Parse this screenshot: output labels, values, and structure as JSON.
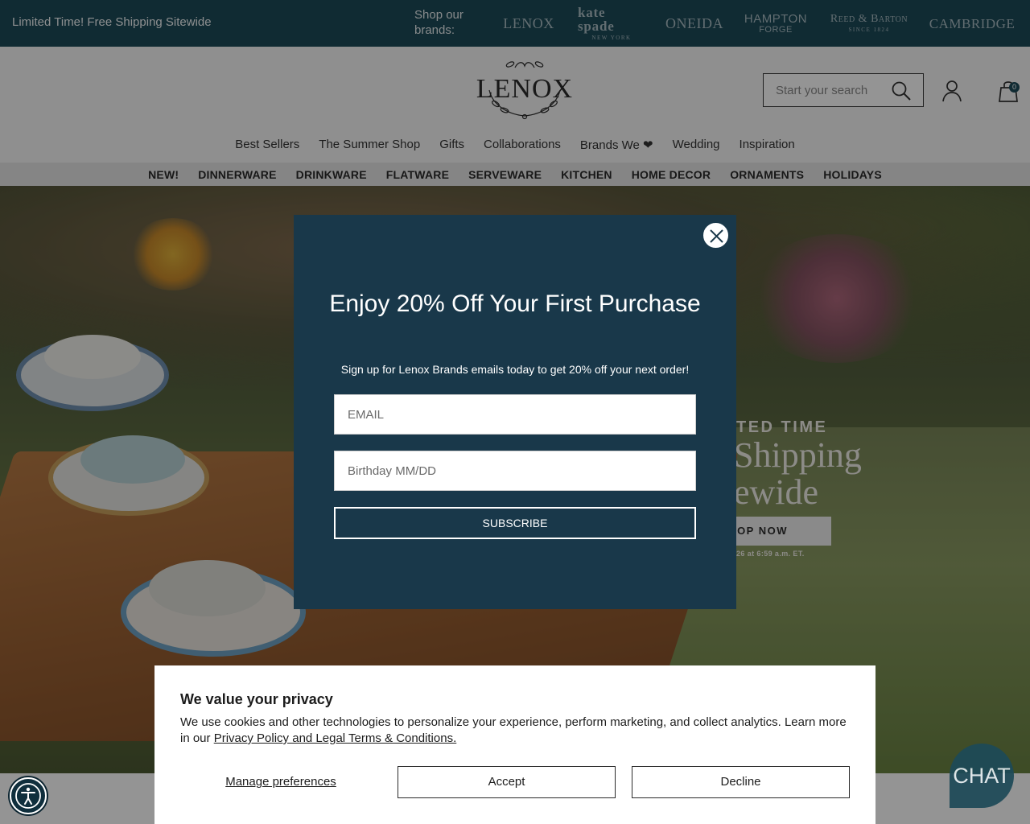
{
  "topbar": {
    "promo": "Limited Time! Free Shipping Sitewide",
    "shop_our_brands": "Shop our brands:",
    "brands": [
      {
        "name": "LENOX",
        "sub": ""
      },
      {
        "name": "kate spade",
        "sub": "NEW YORK"
      },
      {
        "name": "ONEIDA",
        "sub": ""
      },
      {
        "name": "HAMPTON",
        "sub": "FORGE"
      },
      {
        "name": "Reed & Barton",
        "sub": "SINCE 1824"
      },
      {
        "name": "CAMBRIDGE",
        "sub": ""
      }
    ]
  },
  "header": {
    "logo_text": "LENOX",
    "search_placeholder": "Start your search",
    "cart_count": "0",
    "primary_nav": [
      "Best Sellers",
      "The Summer Shop",
      "Gifts",
      "Collaborations",
      "Brands We ❤",
      "Wedding",
      "Inspiration"
    ],
    "category_nav": [
      "NEW!",
      "DINNERWARE",
      "DRINKWARE",
      "FLATWARE",
      "SERVEWARE",
      "KITCHEN",
      "HOME DECOR",
      "ORNAMENTS",
      "HOLIDAYS"
    ]
  },
  "hero": {
    "eyebrow": "TED TIME",
    "headline_line1": "Shipping",
    "headline_line2": "ewide",
    "cta": "OP NOW",
    "disclaimer": "26 at 6:59 a.m. ET."
  },
  "popup": {
    "title": "Enjoy 20% Off Your First Purchase",
    "subtitle": "Sign up for Lenox Brands emails today to get 20% off your next order!",
    "email_placeholder": "EMAIL",
    "birthday_placeholder": "Birthday MM/DD",
    "subscribe_label": "SUBSCRIBE"
  },
  "privacy": {
    "title": "We value your privacy",
    "text": "We use cookies and other technologies to personalize your experience, perform marketing, and collect analytics. Learn more in our ",
    "link": "Privacy Policy and Legal Terms & Conditions.",
    "manage": "Manage preferences",
    "accept": "Accept",
    "decline": "Decline"
  },
  "chat": {
    "label": "CHAT"
  },
  "colors": {
    "brand_teal": "#1d4a58",
    "popup_navy": "#19384a",
    "nav_gray": "#e6e6e6"
  }
}
